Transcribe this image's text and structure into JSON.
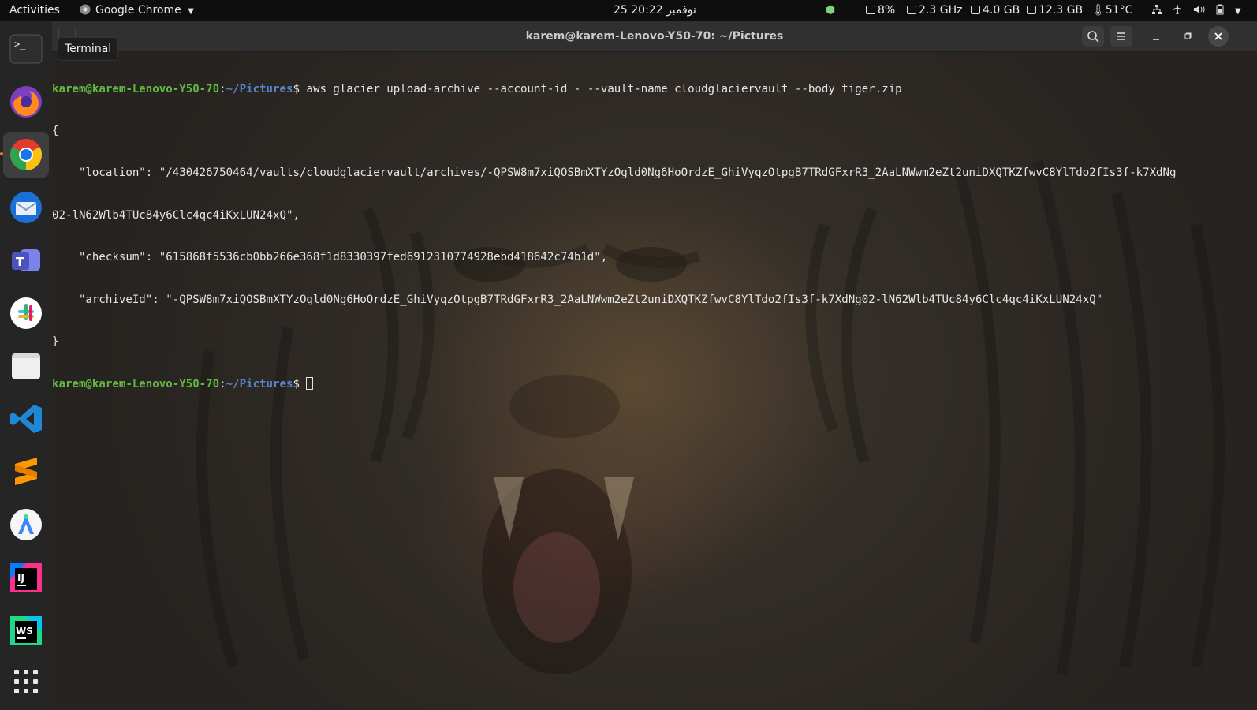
{
  "topbar": {
    "activities": "Activities",
    "app_name": "Google Chrome",
    "clock": "25 نوفمبر  20:22",
    "stats": {
      "cpu": "8%",
      "freq": "2.3 GHz",
      "mem": "4.0 GB",
      "swap": "12.3 GB",
      "temp": "51°C"
    }
  },
  "dock": {
    "items": [
      "terminal-icon",
      "firefox-icon",
      "chrome-icon",
      "thunderbird-icon",
      "teams-icon",
      "slack-icon",
      "files-icon",
      "vscode-icon",
      "sublime-icon",
      "android-studio-icon",
      "intellij-icon",
      "webstorm-icon",
      "show-apps-icon"
    ],
    "tooltip": "Terminal"
  },
  "terminal": {
    "title": "karem@karem-Lenovo-Y50-70: ~/Pictures",
    "prompt_user": "karem@karem-Lenovo-Y50-70",
    "prompt_sep": ":",
    "prompt_path": "~/Pictures",
    "prompt_end": "$ ",
    "command": "aws glacier upload-archive --account-id - --vault-name cloudglaciervault --body tiger.zip",
    "output": [
      "{",
      "    \"location\": \"/430426750464/vaults/cloudglaciervault/archives/-QPSW8m7xiQOSBmXTYzOgld0Ng6HoOrdzE_GhiVyqzOtpgB7TRdGFxrR3_2AaLNWwm2eZt2uniDXQTKZfwvC8YlTdo2fIs3f-k7XdNg",
      "02-lN62Wlb4TUc84y6Clc4qc4iKxLUN24xQ\",",
      "    \"checksum\": \"615868f5536cb0bb266e368f1d8330397fed6912310774928ebd418642c74b1d\",",
      "    \"archiveId\": \"-QPSW8m7xiQOSBmXTYzOgld0Ng6HoOrdzE_GhiVyqzOtpgB7TRdGFxrR3_2AaLNWwm2eZt2uniDXQTKZfwvC8YlTdo2fIs3f-k7XdNg02-lN62Wlb4TUc84y6Clc4qc4iKxLUN24xQ\"",
      "}"
    ]
  }
}
